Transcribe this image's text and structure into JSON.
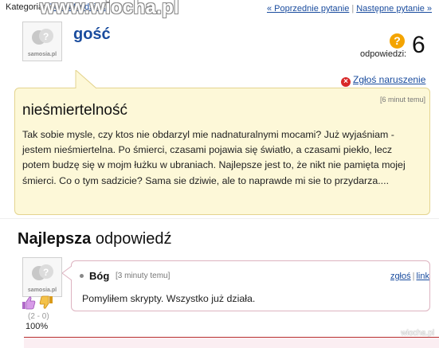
{
  "header": {
    "category_prefix": "Kategoria:",
    "category_link": "Dom i Rodzina",
    "watermark": "www.wiocha.pl",
    "nav_prev": "« Poprzednie pytanie",
    "nav_next": "Następne pytanie »"
  },
  "question": {
    "avatar_brand": "samosia.pl",
    "asker": "gość",
    "answers_label": "odpowiedzi:",
    "answers_count": "6",
    "badge": "?",
    "report_label": "Zgłoś naruszenie",
    "time": "[6 minut temu]",
    "title": "nieśmiertelność",
    "body": "Tak sobie mysle, czy ktos nie obdarzyl mie nadnaturalnymi mocami? Już wyjaśniam - jestem nieśmiertelna. Po śmierci, czasami pojawia się światło, a czasami piekło, lecz potem budzę się w mojm łużku w ubraniach. Najlepsze jest to, że nikt nie pamięta mojej śmierci. Co o tym sadzicie? Sama sie dziwie, ale to naprawde mi sie to przydarza...."
  },
  "best_answer": {
    "heading_bold": "Najlepsza",
    "heading_rest": "odpowiedź",
    "avatar_brand": "samosia.pl",
    "author": "Bóg",
    "time": "[3 minuty temu]",
    "report_link": "zgłoś",
    "link_label": "link",
    "text": "Pomyliłem skrypty. Wszystko już działa.",
    "vote_counts": "(2 - 0)",
    "vote_percent": "100%"
  },
  "colors": {
    "link": "#1a4c9e",
    "question_bg": "#fdf8d8",
    "question_border": "#e4d48f",
    "answer_border": "#ddb3c0",
    "badge": "#f4a400",
    "report_icon": "#d82828"
  },
  "icons": [
    "avatar-bubbles-icon",
    "question-badge-icon",
    "report-icon",
    "thumb-up-icon",
    "thumb-down-icon"
  ],
  "bottom_watermark": "wiocha.pl"
}
